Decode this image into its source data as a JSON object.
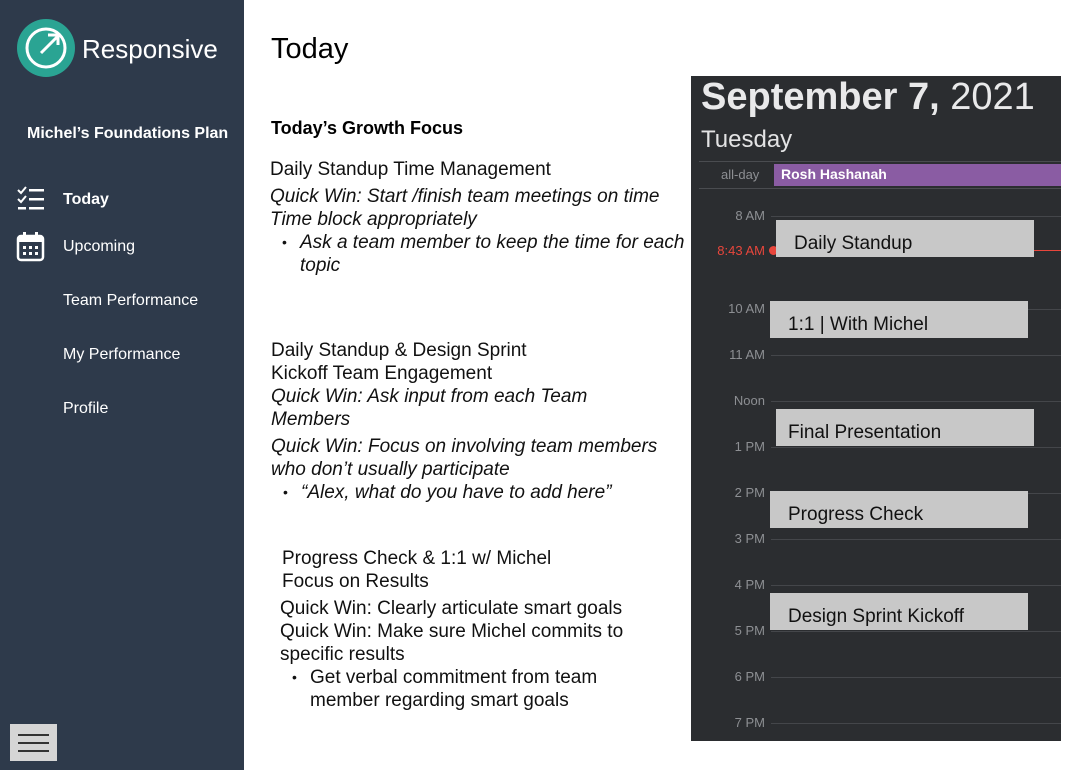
{
  "brand": {
    "name": "Responsive"
  },
  "sidebar": {
    "plan_name": "Michel’s Foundations Plan",
    "items": [
      {
        "label": "Today"
      },
      {
        "label": "Upcoming"
      },
      {
        "label": "Team Performance"
      },
      {
        "label": "My Performance"
      },
      {
        "label": "Profile"
      }
    ]
  },
  "main": {
    "title": "Today",
    "focus_heading": "Today’s Growth Focus",
    "block1": {
      "title": "Daily Standup Time Management",
      "win1": "Quick Win: Start /finish team meetings on time",
      "win2": "Time block appropriately",
      "bullet": "Ask a team member to keep the time for each topic"
    },
    "block2": {
      "title1": "Daily Standup & Design Sprint",
      "title2": "Kickoff Team Engagement",
      "win1": "Quick Win: Ask input from each Team Members",
      "win2": "Quick Win: Focus on involving team members who don’t usually participate",
      "bullet": "“Alex, what do you have to add here”"
    },
    "block3": {
      "title1": "Progress Check & 1:1 w/ Michel",
      "title2": "Focus on Results",
      "win1": "Quick Win: Clearly articulate smart goals",
      "win2": "Quick Win: Make sure Michel commits to specific results",
      "bullet": "Get verbal commitment from team member regarding smart goals"
    }
  },
  "calendar": {
    "month_day": "September 7,",
    "year": "2021",
    "weekday": "Tuesday",
    "allday_label": "all-day",
    "allday_event": "Rosh Hashanah",
    "now_time": "8:43 AM",
    "hours": [
      "8 AM",
      "10 AM",
      "11 AM",
      "Noon",
      "1 PM",
      "2 PM",
      "3 PM",
      "4 PM",
      "5 PM",
      "6 PM",
      "7 PM"
    ],
    "events": [
      {
        "title": "Daily Standup"
      },
      {
        "title": "1:1 | With Michel"
      },
      {
        "title": "Final Presentation"
      },
      {
        "title": "Progress Check"
      },
      {
        "title": "Design Sprint Kickoff"
      }
    ],
    "colors": {
      "background": "#2b2d30",
      "allday_event": "#8a5ca3",
      "now_indicator": "#e8463c",
      "event_block": "#c8c8c8"
    }
  },
  "colors": {
    "sidebar": "#2e3a4b",
    "logo": "#2aa493"
  }
}
